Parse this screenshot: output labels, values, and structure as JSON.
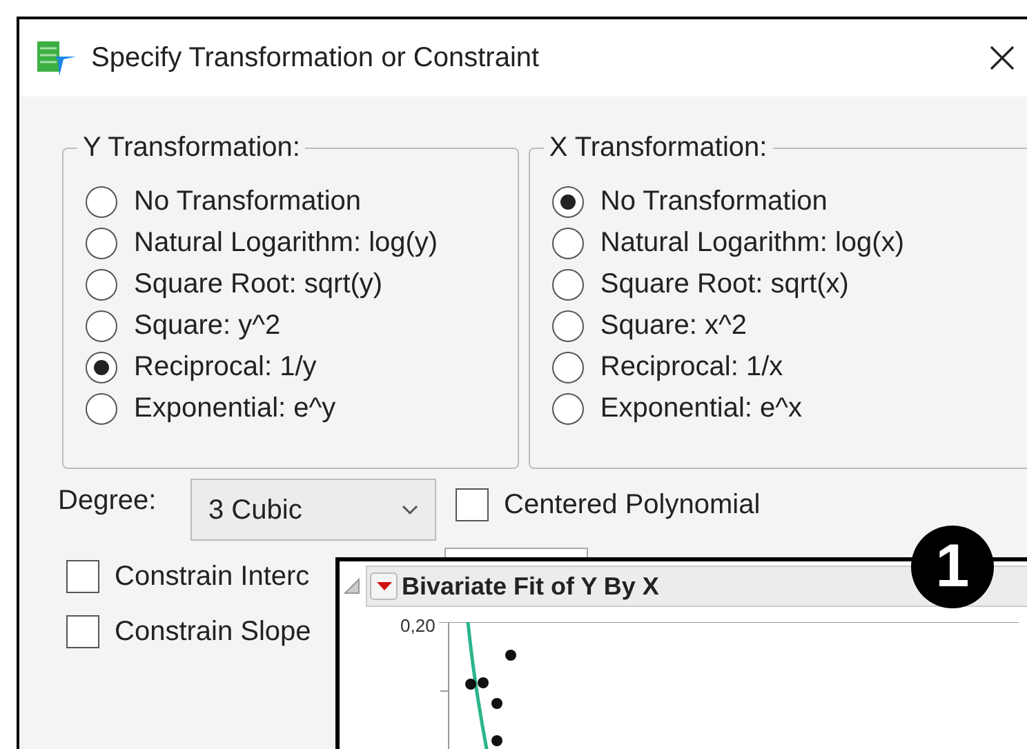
{
  "window": {
    "title": "Specify Transformation or Constraint"
  },
  "groups": [
    {
      "title": "Y Transformation:",
      "options": [
        {
          "label": "No Transformation",
          "selected": false
        },
        {
          "label": "Natural Logarithm: log(y)",
          "selected": false
        },
        {
          "label": "Square Root: sqrt(y)",
          "selected": false
        },
        {
          "label": "Square: y^2",
          "selected": false
        },
        {
          "label": "Reciprocal: 1/y",
          "selected": true
        },
        {
          "label": "Exponential: e^y",
          "selected": false
        }
      ]
    },
    {
      "title": "X Transformation:",
      "options": [
        {
          "label": "No Transformation",
          "selected": true
        },
        {
          "label": "Natural Logarithm: log(x)",
          "selected": false
        },
        {
          "label": "Square Root: sqrt(x)",
          "selected": false
        },
        {
          "label": "Square: x^2",
          "selected": false
        },
        {
          "label": "Reciprocal: 1/x",
          "selected": false
        },
        {
          "label": "Exponential: e^x",
          "selected": false
        }
      ]
    }
  ],
  "degree": {
    "label": "Degree:",
    "value": "3 Cubic"
  },
  "centered": {
    "label": "Centered Polynomial",
    "checked": false
  },
  "constraints": [
    {
      "label": "Constrain Interc",
      "checked": false
    },
    {
      "label": "Constrain Slope",
      "checked": false
    }
  ],
  "report": {
    "title": "Bivariate Fit of Y By X",
    "y_tick": "0,20"
  },
  "callout": "1"
}
